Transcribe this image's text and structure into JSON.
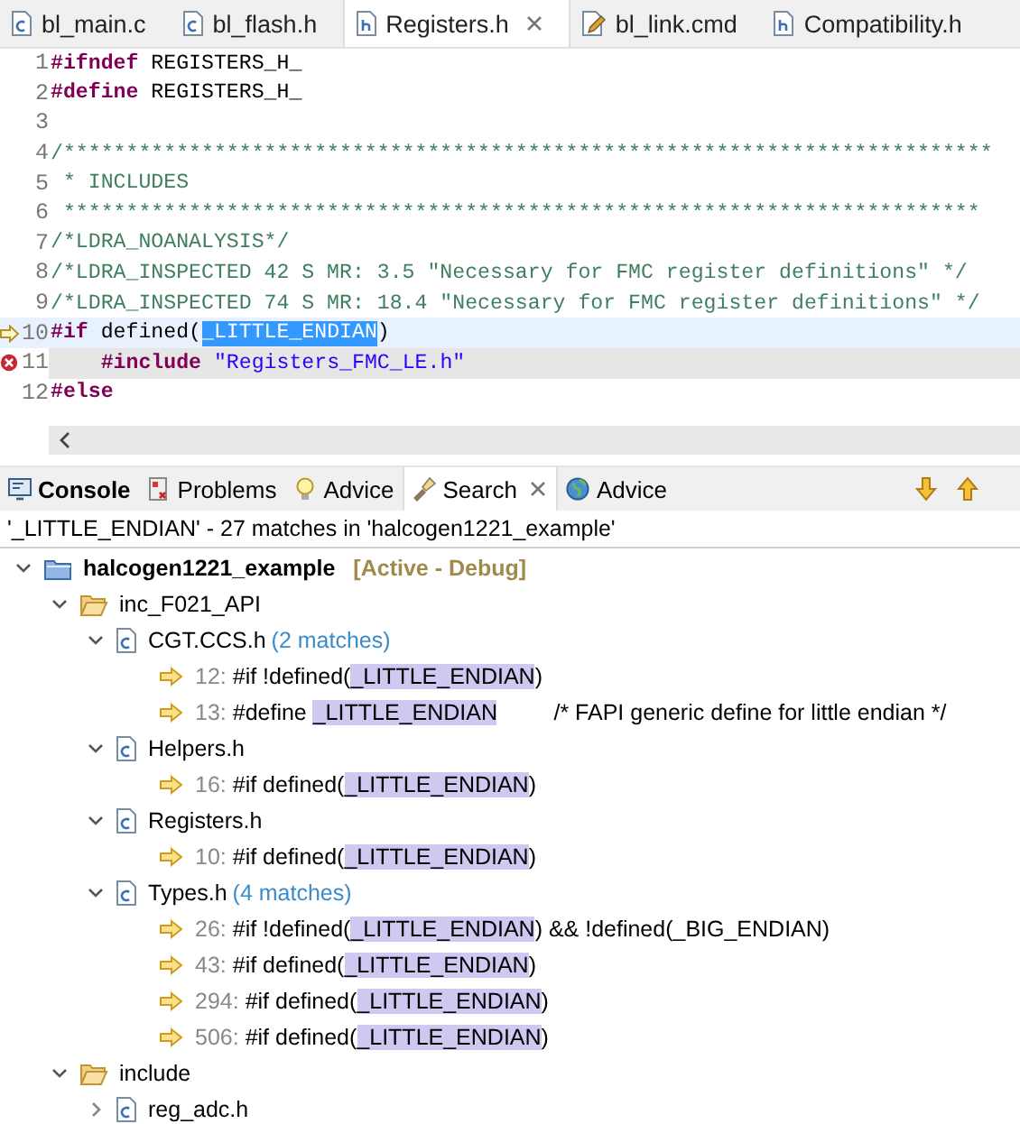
{
  "editor_tabs": [
    {
      "label": "bl_main.c",
      "kind": "c",
      "selected": false,
      "closable": false
    },
    {
      "label": "bl_flash.h",
      "kind": "c",
      "selected": false,
      "closable": false
    },
    {
      "label": "Registers.h",
      "kind": "h",
      "selected": true,
      "closable": true
    },
    {
      "label": "bl_link.cmd",
      "kind": "cmd",
      "selected": false,
      "closable": false
    },
    {
      "label": "Compatibility.h",
      "kind": "h",
      "selected": false,
      "closable": false
    }
  ],
  "code_lines": [
    {
      "number": "1",
      "segments": [
        {
          "kind": "keyword",
          "text": "#ifndef"
        },
        {
          "kind": "plain",
          "text": " REGISTERS_H_"
        }
      ]
    },
    {
      "number": "2",
      "segments": [
        {
          "kind": "keyword",
          "text": "#define"
        },
        {
          "kind": "plain",
          "text": " REGISTERS_H_"
        }
      ]
    },
    {
      "number": "3"
    },
    {
      "number": "4",
      "segments": [
        {
          "kind": "comment",
          "text": "/**************************************************************************"
        }
      ]
    },
    {
      "number": "5",
      "segments": [
        {
          "kind": "comment",
          "text": " * INCLUDES"
        }
      ]
    },
    {
      "number": "6",
      "segments": [
        {
          "kind": "comment",
          "text": " *************************************************************************"
        }
      ]
    },
    {
      "number": "7",
      "segments": [
        {
          "kind": "comment",
          "text": "/*LDRA_NOANALYSIS*/"
        }
      ]
    },
    {
      "number": "8",
      "segments": [
        {
          "kind": "comment",
          "text": "/*LDRA_INSPECTED 42 S MR: 3.5 \"Necessary for FMC register definitions\" */"
        }
      ]
    },
    {
      "number": "9",
      "segments": [
        {
          "kind": "comment",
          "text": "/*LDRA_INSPECTED 74 S MR: 18.4 \"Necessary for FMC register definitions\" */"
        }
      ]
    },
    {
      "number": "10",
      "kind": "current",
      "segments": [
        {
          "kind": "keyword",
          "text": "#if"
        },
        {
          "kind": "plain",
          "text": " defined("
        },
        {
          "kind": "selection",
          "text": "_LITTLE_ENDIAN"
        },
        {
          "kind": "plain",
          "text": ")"
        }
      ]
    },
    {
      "number": "11",
      "kind": "error",
      "segments": [
        {
          "kind": "keyword",
          "text": "    #include"
        },
        {
          "kind": "string",
          "text": " \"Registers_FMC_LE.h\""
        }
      ]
    },
    {
      "number": "12",
      "segments": [
        {
          "kind": "keyword",
          "text": "#else"
        }
      ]
    }
  ],
  "view_tabs": [
    {
      "label": "Console",
      "kind": "console",
      "selected": false,
      "closable": false,
      "bold": true
    },
    {
      "label": "Problems",
      "kind": "problems",
      "selected": false,
      "closable": false,
      "bold": false
    },
    {
      "label": "Advice",
      "kind": "bulb",
      "selected": false,
      "closable": false,
      "bold": false
    },
    {
      "label": "Search",
      "kind": "search",
      "selected": true,
      "closable": true,
      "bold": false
    },
    {
      "label": "Advice",
      "kind": "globe",
      "selected": false,
      "closable": false,
      "bold": false
    }
  ],
  "search_summary": "'_LITTLE_ENDIAN' - 27 matches in 'halcogen1221_example'",
  "results": [
    {
      "kind": "project",
      "name": "halcogen1221_example",
      "note": "[Active - Debug]",
      "expanded": true,
      "children": [
        {
          "kind": "folder",
          "name": "inc_F021_API",
          "expanded": true,
          "children": [
            {
              "kind": "file",
              "name": "CGT.CCS.h",
              "note": "(2 matches)",
              "expanded": true,
              "children": [
                {
                  "kind": "match",
                  "line": "12:",
                  "before": "#if !defined(",
                  "match": "_LITTLE_ENDIAN",
                  "after": ")"
                },
                {
                  "kind": "match",
                  "line": "13:",
                  "before": "#define ",
                  "match": "_LITTLE_ENDIAN",
                  "after": "         /* FAPI generic define for little endian */"
                }
              ]
            },
            {
              "kind": "file",
              "name": "Helpers.h",
              "expanded": true,
              "children": [
                {
                  "kind": "match",
                  "line": "16:",
                  "before": "#if defined(",
                  "match": "_LITTLE_ENDIAN",
                  "after": ")"
                }
              ]
            },
            {
              "kind": "file",
              "name": "Registers.h",
              "expanded": true,
              "children": [
                {
                  "kind": "match",
                  "line": "10:",
                  "before": "#if defined(",
                  "match": "_LITTLE_ENDIAN",
                  "after": ")"
                }
              ]
            },
            {
              "kind": "file",
              "name": "Types.h",
              "note": "(4 matches)",
              "expanded": true,
              "children": [
                {
                  "kind": "match",
                  "line": "26:",
                  "before": "#if !defined(",
                  "match": "_LITTLE_ENDIAN",
                  "after": ") && !defined(_BIG_ENDIAN)"
                },
                {
                  "kind": "match",
                  "line": "43:",
                  "before": "#if defined(",
                  "match": "_LITTLE_ENDIAN",
                  "after": ")"
                },
                {
                  "kind": "match",
                  "line": "294:",
                  "before": "#if defined(",
                  "match": "_LITTLE_ENDIAN",
                  "after": ")"
                },
                {
                  "kind": "match",
                  "line": "506:",
                  "before": "#if defined(",
                  "match": "_LITTLE_ENDIAN",
                  "after": ")"
                }
              ]
            }
          ]
        },
        {
          "kind": "folder",
          "name": "include",
          "expanded": true,
          "children": [
            {
              "kind": "file",
              "name": "reg_adc.h",
              "expanded": false
            }
          ]
        }
      ]
    }
  ]
}
